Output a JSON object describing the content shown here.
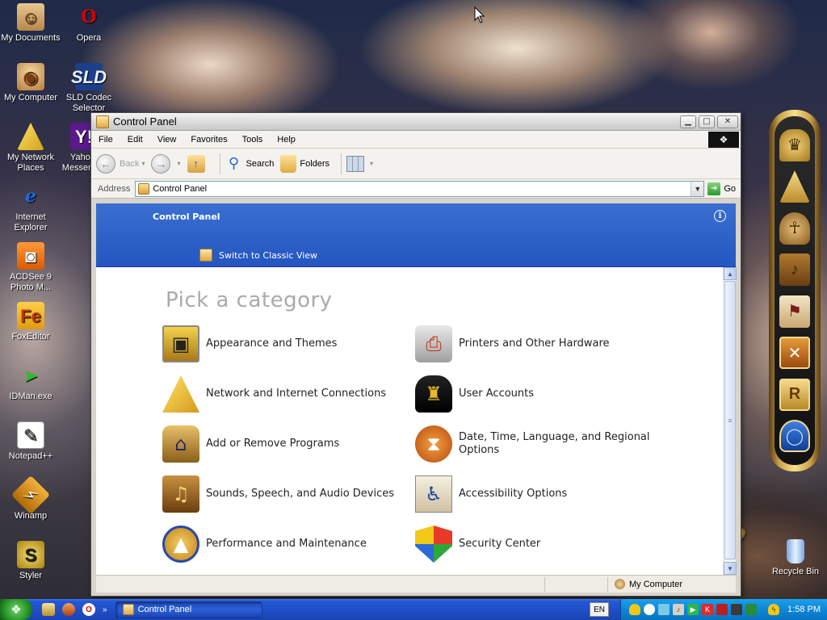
{
  "desktop": {
    "icons": [
      {
        "id": "my-documents",
        "label": "My Documents",
        "glyph": "☺"
      },
      {
        "id": "opera",
        "label": "Opera",
        "glyph": "O"
      },
      {
        "id": "my-computer",
        "label": "My Computer",
        "glyph": "◉"
      },
      {
        "id": "sld-codec",
        "label": "SLD Codec Selector",
        "glyph": "SLD"
      },
      {
        "id": "my-network-places",
        "label": "My Network Places",
        "glyph": ""
      },
      {
        "id": "yahoo-messenger",
        "label": "Yahoo! Messenger",
        "glyph": "Y!"
      },
      {
        "id": "internet-explorer",
        "label": "Internet Explorer",
        "glyph": "e"
      },
      {
        "id": "acdsee",
        "label": "ACDSee 9 Photo M...",
        "glyph": "◙"
      },
      {
        "id": "foxeditor",
        "label": "FoxEditor",
        "glyph": "Fe"
      },
      {
        "id": "idman",
        "label": "IDMan.exe",
        "glyph": "➤"
      },
      {
        "id": "notepadpp",
        "label": "Notepad++",
        "glyph": "✎"
      },
      {
        "id": "winamp",
        "label": "Winamp",
        "glyph": "⚡"
      },
      {
        "id": "styler",
        "label": "Styler",
        "glyph": "S"
      }
    ],
    "recycle_bin": "Recycle Bin",
    "dock_glyphs": [
      "♛",
      "",
      "☥",
      "♪",
      "⚑",
      "✕",
      "R",
      "◯"
    ]
  },
  "window": {
    "title": "Control Panel",
    "menu": [
      "File",
      "Edit",
      "View",
      "Favorites",
      "Tools",
      "Help"
    ],
    "toolbar": {
      "back": "Back",
      "search": "Search",
      "folders": "Folders"
    },
    "address": {
      "label": "Address",
      "value": "Control Panel",
      "go": "Go"
    },
    "header": {
      "title": "Control Panel",
      "switch_view": "Switch to Classic View"
    },
    "heading": "Pick a category",
    "categories": [
      {
        "id": "appearance",
        "label": "Appearance and Themes",
        "glyph": "▣"
      },
      {
        "id": "printers",
        "label": "Printers and Other Hardware",
        "glyph": "⎙"
      },
      {
        "id": "network",
        "label": "Network and Internet Connections",
        "glyph": ""
      },
      {
        "id": "users",
        "label": "User Accounts",
        "glyph": "♜"
      },
      {
        "id": "add-remove",
        "label": "Add or Remove Programs",
        "glyph": "⌂"
      },
      {
        "id": "date-time",
        "label": "Date, Time, Language, and Regional Options",
        "glyph": "⧗"
      },
      {
        "id": "sounds",
        "label": "Sounds, Speech, and Audio Devices",
        "glyph": "♫"
      },
      {
        "id": "accessibility",
        "label": "Accessibility Options",
        "glyph": "♿"
      },
      {
        "id": "performance",
        "label": "Performance and Maintenance",
        "glyph": "▲"
      },
      {
        "id": "security",
        "label": "Security Center",
        "glyph": ""
      }
    ],
    "status": {
      "location": "My Computer"
    }
  },
  "taskbar": {
    "task_button": "Control Panel",
    "language": "EN",
    "clock": "1:58 PM"
  }
}
